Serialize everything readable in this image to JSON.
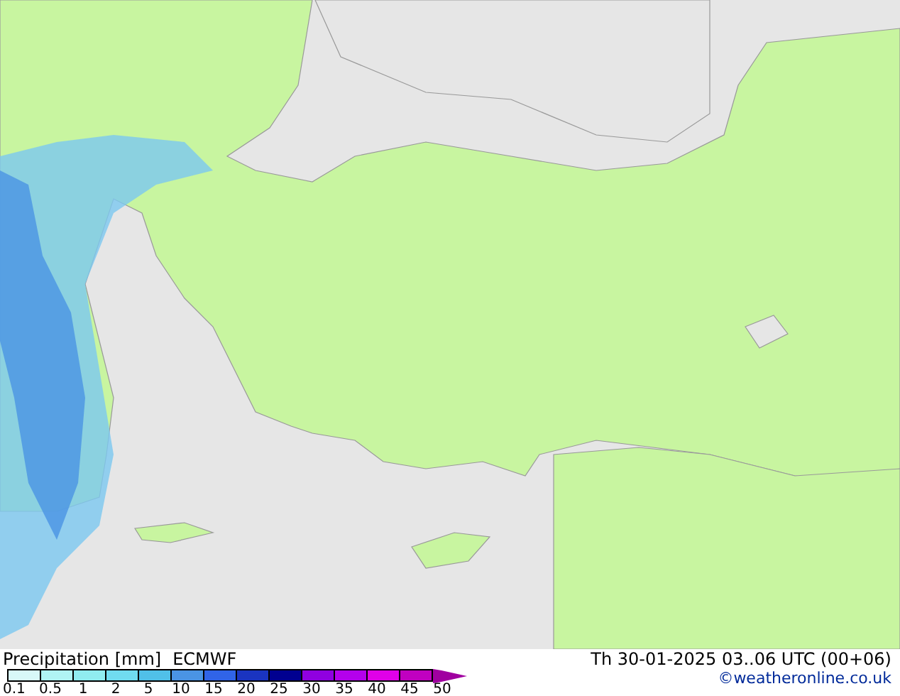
{
  "legend": {
    "title": "Precipitation [mm]",
    "model": "ECMWF",
    "swatches": [
      {
        "color": "#d8f8f8"
      },
      {
        "color": "#b0f4f4"
      },
      {
        "color": "#90ecf0"
      },
      {
        "color": "#70dcf0"
      },
      {
        "color": "#50c0e8"
      },
      {
        "color": "#4a94e4"
      },
      {
        "color": "#3064e8"
      },
      {
        "color": "#1a34c0"
      },
      {
        "color": "#000090"
      },
      {
        "color": "#9000e0"
      },
      {
        "color": "#b400ec"
      },
      {
        "color": "#e000e8"
      },
      {
        "color": "#c000c0"
      },
      {
        "kind": "arrow",
        "color": "#a000a0"
      }
    ],
    "labels": [
      "0.1",
      "0.5",
      "1",
      "2",
      "5",
      "10",
      "15",
      "20",
      "25",
      "30",
      "35",
      "40",
      "45",
      "50"
    ]
  },
  "valid_time": "Th 30-01-2025 03..06 UTC (00+06)",
  "credit": "©weatheronline.co.uk"
}
